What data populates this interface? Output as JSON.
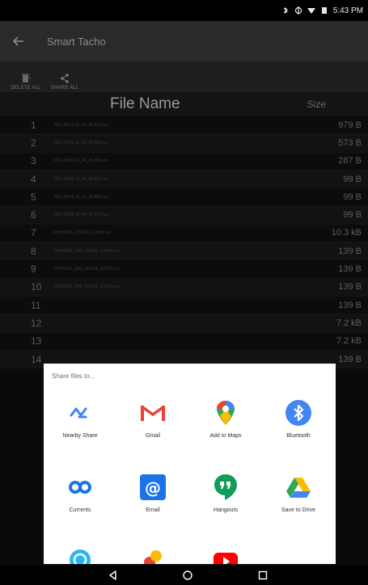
{
  "status_bar": {
    "time": "5:43 PM"
  },
  "app": {
    "title": "Smart Tacho"
  },
  "toolbar": {
    "delete_all": "DELETE ALL",
    "share_all": "SHARE ALL"
  },
  "table": {
    "col_name": "File Name",
    "col_size": "Size",
    "rows": [
      {
        "num": "1",
        "name": "2021-04-21 15_34_06.074.csv",
        "size": "979 B"
      },
      {
        "num": "2",
        "name": "2021-04-21 11_01_24.205.csv",
        "size": "573 B"
      },
      {
        "num": "3",
        "name": "2021-08-09 16_34_00.980.csv",
        "size": "287 B"
      },
      {
        "num": "4",
        "name": "2021-08-09 16_47_08.657.csv",
        "size": "99 B"
      },
      {
        "num": "5",
        "name": "2021-08-09 15_22_23.803.csv",
        "size": "99 B"
      },
      {
        "num": "6",
        "name": "2021-08-09 15_44_41.572.csv",
        "size": "99 B"
      },
      {
        "num": "7",
        "name": "DH250001_201209_114555.csv",
        "size": "10.3 kB"
      },
      {
        "num": "8",
        "name": "DH250001_999_201209_114753.csv",
        "size": "139 B"
      },
      {
        "num": "9",
        "name": "DH250001_999_201209_114713.csv",
        "size": "139 B"
      },
      {
        "num": "10",
        "name": "DH250001_999_201209_113740.csv",
        "size": "139 B"
      },
      {
        "num": "11",
        "name": "",
        "size": "139 B"
      },
      {
        "num": "12",
        "name": "",
        "size": "7.2 kB"
      },
      {
        "num": "13",
        "name": "",
        "size": "7.2 kB"
      },
      {
        "num": "14",
        "name": "",
        "size": "139 B"
      }
    ]
  },
  "share_sheet": {
    "title": "Share files to...",
    "apps": [
      {
        "label": "Nearby Share",
        "icon": "nearby-share-icon"
      },
      {
        "label": "Gmail",
        "icon": "gmail-icon"
      },
      {
        "label": "Add to Maps",
        "icon": "maps-icon"
      },
      {
        "label": "Bluetooth",
        "icon": "bluetooth-icon"
      },
      {
        "label": "Currents",
        "icon": "currents-icon"
      },
      {
        "label": "Email",
        "icon": "email-icon"
      },
      {
        "label": "Hangouts",
        "icon": "hangouts-icon"
      },
      {
        "label": "Save to Drive",
        "icon": "drive-icon"
      }
    ]
  },
  "colors": {
    "accent_blue": "#4285f4",
    "gmail_red": "#ea4335",
    "drive_green": "#34a853",
    "drive_yellow": "#fbbc04"
  }
}
